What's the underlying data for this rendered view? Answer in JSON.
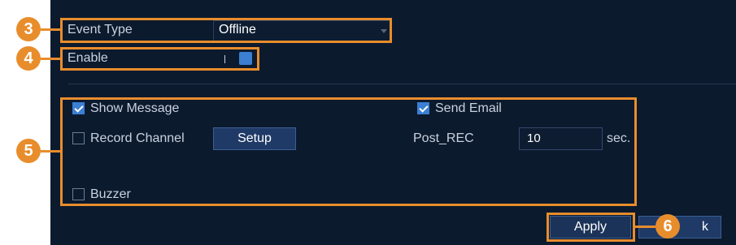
{
  "event_type": {
    "label": "Event Type",
    "value": "Offline"
  },
  "enable": {
    "label": "Enable",
    "state": "on"
  },
  "options": {
    "show_message": {
      "label": "Show Message",
      "checked": true
    },
    "send_email": {
      "label": "Send Email",
      "checked": true
    },
    "record_channel": {
      "label": "Record Channel",
      "checked": false
    },
    "setup_button": "Setup",
    "post_rec": {
      "label": "Post_REC",
      "value": "10",
      "unit": "sec."
    },
    "buzzer": {
      "label": "Buzzer",
      "checked": false
    }
  },
  "buttons": {
    "apply": "Apply",
    "back_partial": "k"
  },
  "callouts": [
    "3",
    "4",
    "5",
    "6"
  ],
  "colors": {
    "background": "#0c1a2e",
    "highlight": "#e88d2c",
    "button": "#1f3a66",
    "checkbox": "#3b7fd4"
  }
}
